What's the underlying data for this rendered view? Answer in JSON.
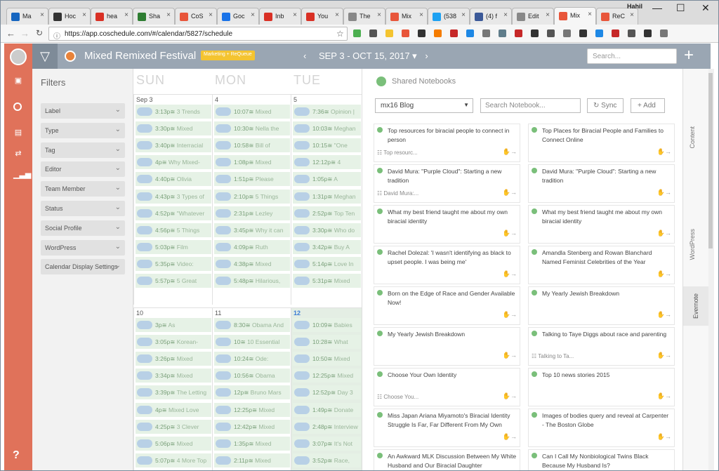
{
  "browser": {
    "user": "Hahil",
    "url": "https://app.coschedule.com/#/calendar/5827/schedule",
    "tabs": [
      {
        "label": "Ma",
        "color": "#1565c0"
      },
      {
        "label": "Hoc",
        "color": "#333333"
      },
      {
        "label": "hea",
        "color": "#d93025"
      },
      {
        "label": "Sha",
        "color": "#2e7d32"
      },
      {
        "label": "CoS",
        "color": "#e8553a"
      },
      {
        "label": "Goc",
        "color": "#1a73e8"
      },
      {
        "label": "Inb",
        "color": "#d93025"
      },
      {
        "label": "You",
        "color": "#d93025"
      },
      {
        "label": "The",
        "color": "#888888"
      },
      {
        "label": "Mix",
        "color": "#e8553a"
      },
      {
        "label": "(538",
        "color": "#1da1f2"
      },
      {
        "label": "(4) f",
        "color": "#3b5998"
      },
      {
        "label": "Edit",
        "color": "#888888"
      },
      {
        "label": "Mix",
        "color": "#e8553a"
      },
      {
        "label": "ReC",
        "color": "#e8553a"
      }
    ]
  },
  "app": {
    "calendar_title": "Mixed Remixed Festival",
    "badge": "Marketing + ReQueue",
    "date_range": "SEP 3 - OCT 15, 2017 ▾",
    "search_placeholder": "Search...",
    "help": "?"
  },
  "filters": {
    "title": "Filters",
    "items": [
      "Label",
      "Type",
      "Tag",
      "Editor",
      "Team Member",
      "Status",
      "Social Profile",
      "WordPress",
      "Calendar Display Settings"
    ]
  },
  "calendar": {
    "days": [
      "SUN",
      "MON",
      "TUE"
    ],
    "week1": {
      "dates": [
        "Sep 3",
        "4",
        "5"
      ],
      "sun": [
        [
          "3:13p",
          "3 Trends"
        ],
        [
          "3:30p",
          "Mixed"
        ],
        [
          "3:40p",
          "Interracial"
        ],
        [
          "4p",
          "Why Mixed-"
        ],
        [
          "4:40p",
          "Olivia"
        ],
        [
          "4:43p",
          "3 Types of"
        ],
        [
          "4:52p",
          "\"Whatever"
        ],
        [
          "4:56p",
          "5 Things"
        ],
        [
          "5:03p",
          "Film"
        ],
        [
          "5:35p",
          "Video:"
        ],
        [
          "5:57p",
          "5 Great"
        ]
      ],
      "mon": [
        [
          "10:07",
          "Mixed"
        ],
        [
          "10:30",
          "Nella the"
        ],
        [
          "10:58",
          "Bill of"
        ],
        [
          "1:08p",
          "Mixed"
        ],
        [
          "1:51p",
          "Please"
        ],
        [
          "2:10p",
          "5 Things"
        ],
        [
          "2:31p",
          "Lezley"
        ],
        [
          "3:45p",
          "Why it can"
        ],
        [
          "4:09p",
          "Ruth"
        ],
        [
          "4:38p",
          "Mixed"
        ],
        [
          "5:48p",
          "Hilarious,"
        ]
      ],
      "tue": [
        [
          "7:36",
          "Opinion |"
        ],
        [
          "10:03",
          "Meghan"
        ],
        [
          "10:15",
          "\"One"
        ],
        [
          "12:12p",
          "4"
        ],
        [
          "1:05p",
          "A"
        ],
        [
          "1:31p",
          "Meghan"
        ],
        [
          "2:52p",
          "Top Ten"
        ],
        [
          "3:30p",
          "Who do"
        ],
        [
          "3:42p",
          "Buy A"
        ],
        [
          "5:14p",
          "Love In"
        ],
        [
          "5:31p",
          "Mixed"
        ]
      ]
    },
    "week2": {
      "dates": [
        "10",
        "11",
        "12"
      ],
      "sun": [
        [
          "3p",
          "As"
        ],
        [
          "3:05p",
          "Korean-"
        ],
        [
          "3:26p",
          "Mixed"
        ],
        [
          "3:34p",
          "Mixed"
        ],
        [
          "3:39p",
          "The Letting"
        ],
        [
          "4p",
          "Mixed Love"
        ],
        [
          "4:25p",
          "3 Clever"
        ],
        [
          "5:06p",
          "Mixed"
        ],
        [
          "5:07p",
          "4 More Top"
        ]
      ],
      "mon": [
        [
          "8:30",
          "Obama And"
        ],
        [
          "10",
          "10 Essential"
        ],
        [
          "10:24",
          "Ode:"
        ],
        [
          "10:56",
          "Obama"
        ],
        [
          "12p",
          "Bruno Mars"
        ],
        [
          "12:25p",
          "Mixed"
        ],
        [
          "12:42p",
          "Mixed"
        ],
        [
          "1:35p",
          "Mixed"
        ],
        [
          "2:11p",
          "Mixed"
        ]
      ],
      "tue": [
        [
          "10:09",
          "Babies"
        ],
        [
          "10:28",
          "What"
        ],
        [
          "10:50",
          "Mixed"
        ],
        [
          "12:25p",
          "Mixed"
        ],
        [
          "12:52p",
          "Day 3"
        ],
        [
          "1:49p",
          "Donate"
        ],
        [
          "2:48p",
          "Interview"
        ],
        [
          "3:07p",
          "It's Not"
        ],
        [
          "3:52p",
          "Race,"
        ]
      ]
    }
  },
  "notebooks": {
    "title": "Shared Notebooks",
    "selected": "mx16 Blog",
    "search_placeholder": "Search Notebook...",
    "sync": "Sync",
    "add": "Add",
    "cards": [
      {
        "title": "Top resources for biracial people to connect in person",
        "note": "Top resourc..."
      },
      {
        "title": "Top Places for Biracial People and Families to Connect Online",
        "note": ""
      },
      {
        "title": "David Mura: \"Purple Cloud\": Starting a new tradition",
        "note": "David Mura:..."
      },
      {
        "title": "David Mura: \"Purple Cloud\": Starting a new tradition",
        "note": ""
      },
      {
        "title": "What my best friend taught me about my own biracial identity",
        "note": ""
      },
      {
        "title": "What my best friend taught me about my own biracial identity",
        "note": ""
      },
      {
        "title": "Rachel Dolezal: 'I wasn't identifying as black to upset people. I was being me'",
        "note": ""
      },
      {
        "title": "Amandla Stenberg and Rowan Blanchard Named Feminist Celebrities of the Year",
        "note": ""
      },
      {
        "title": "Born on the Edge of Race and Gender Available Now!",
        "note": ""
      },
      {
        "title": "My Yearly Jewish Breakdown",
        "note": ""
      },
      {
        "title": "My Yearly Jewish Breakdown",
        "note": ""
      },
      {
        "title": "Talking to Taye Diggs about race and parenting",
        "note": "Talking to Ta..."
      },
      {
        "title": "Choose Your Own Identity",
        "note": "Choose You..."
      },
      {
        "title": "Top 10 news stories 2015",
        "note": ""
      },
      {
        "title": "Miss Japan Ariana Miyamoto's Biracial Identity Struggle Is Far, Far Different From My Own",
        "note": ""
      },
      {
        "title": "Images of bodies query and reveal at Carpenter - The Boston Globe",
        "note": ""
      },
      {
        "title": "An Awkward MLK Discussion Between My White Husband and Our Biracial Daughter",
        "note": ""
      },
      {
        "title": "Can I Call My Nonbiological Twins Black Because My Husband Is?",
        "note": ""
      }
    ]
  },
  "right_tabs": [
    "Content",
    "WordPress",
    "Evernote"
  ]
}
